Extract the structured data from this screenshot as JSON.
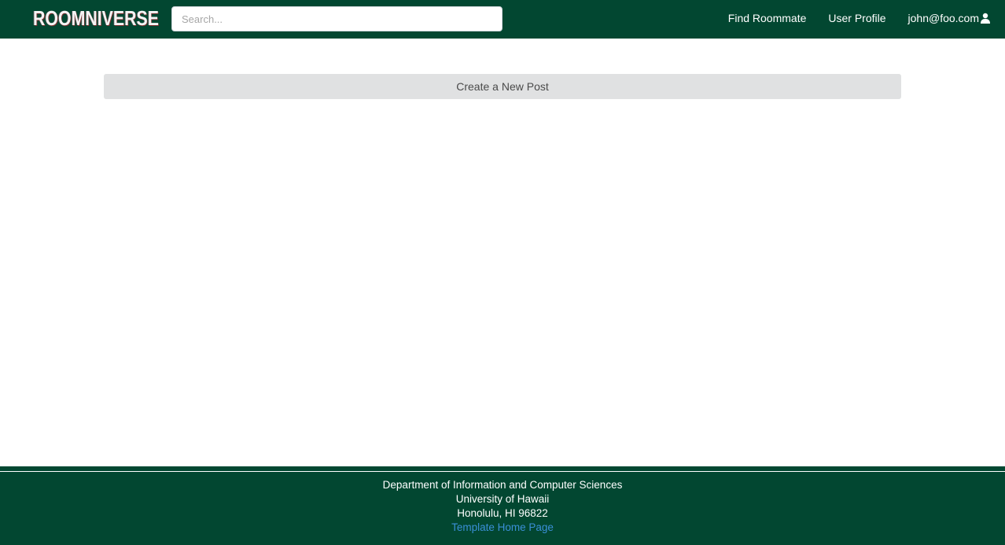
{
  "navbar": {
    "logo_text": "ROOMNIVERSE",
    "search_placeholder": "Search...",
    "links": {
      "find_roommate": "Find Roommate",
      "user_profile": "User Profile",
      "user_email": "john@foo.com"
    },
    "user_icon": "user-icon"
  },
  "main": {
    "create_post_label": "Create a New Post"
  },
  "footer": {
    "line1": "Department of Information and Computer Sciences",
    "line2": "University of Hawaii",
    "line3": "Honolulu, HI 96822",
    "link_label": "Template Home Page"
  },
  "colors": {
    "brand_green": "#024731",
    "button_gray": "#e0e1e2",
    "link_blue": "#3a8fd6"
  }
}
